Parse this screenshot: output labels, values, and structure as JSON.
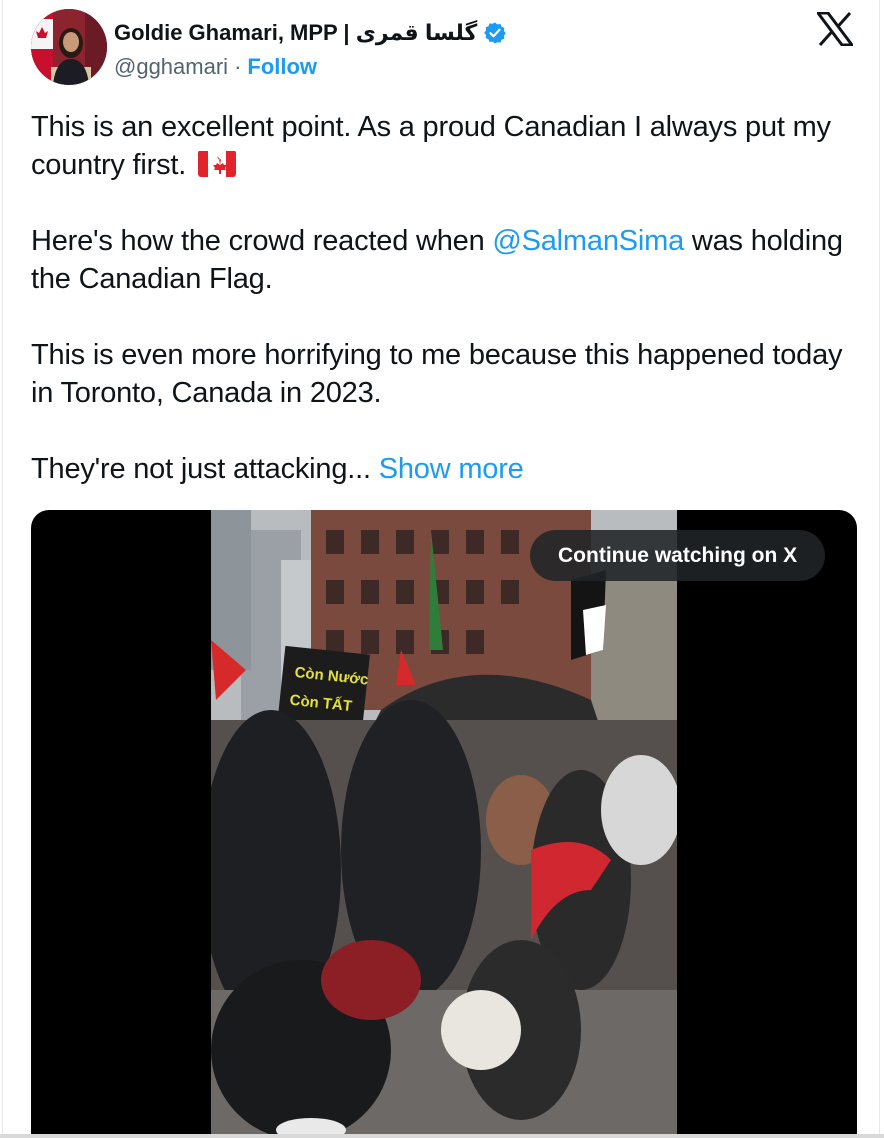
{
  "author": {
    "name": "Goldie Ghamari, MPP | گلسا قمری",
    "handle": "@gghamari",
    "separator": "·",
    "follow_label": "Follow",
    "verified_icon": "verified-badge-icon"
  },
  "tweet": {
    "paragraph1": "This is an excellent point. As a proud Canadian I always put my country first.",
    "flag_icon": "canada-flag-emoji",
    "paragraph2_before": "Here's how the crowd reacted when ",
    "mention": "@SalmanSima",
    "paragraph2_after": " was holding the Canadian Flag.",
    "paragraph3": "This is even more horrifying to me because this happened today in Toronto, Canada in 2023.",
    "paragraph4": "They're not just attacking...",
    "show_more_label": "Show more"
  },
  "media": {
    "overlay_label": "Continue watching on X",
    "sign_text_line1": "Còn Nước",
    "sign_text_line2": "Còn TẤT"
  },
  "colors": {
    "accent": "#1d9bf0",
    "text": "#0f1419",
    "secondary_text": "#536471"
  }
}
